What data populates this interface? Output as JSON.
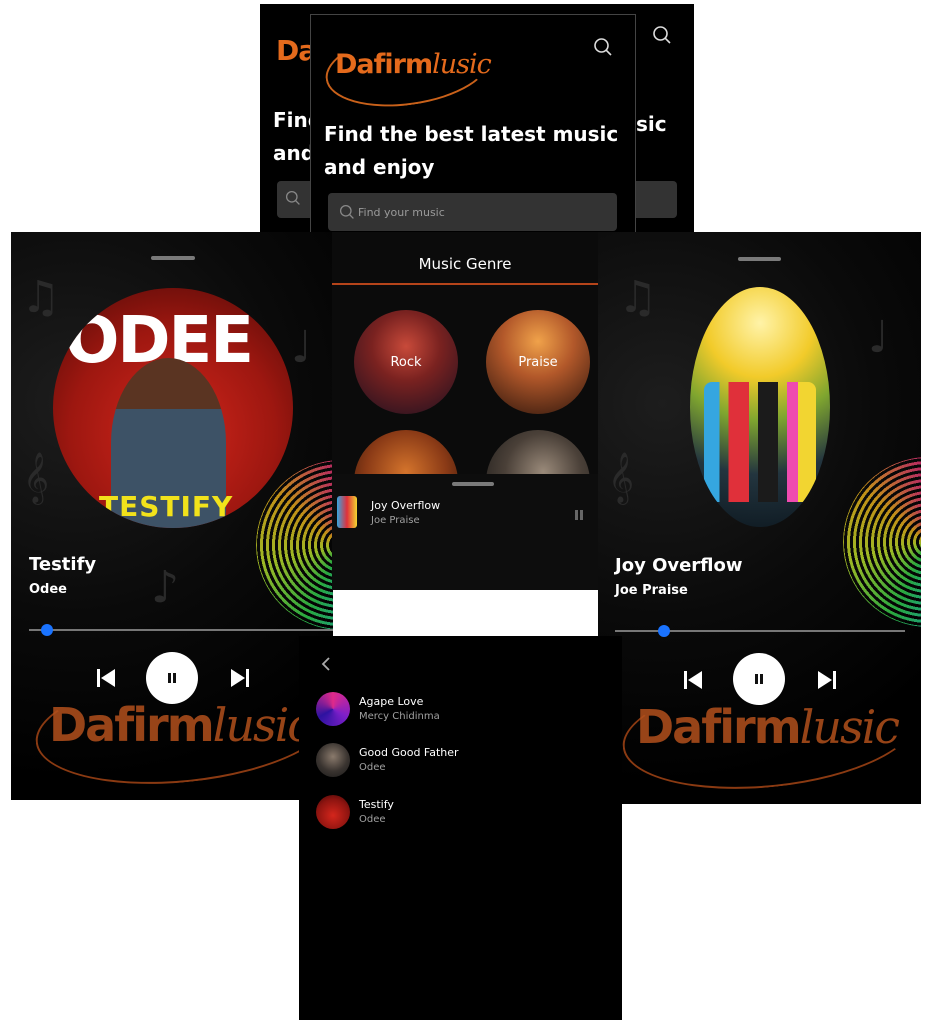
{
  "logo": {
    "part1": "Dafirm",
    "part2": "lusic"
  },
  "home": {
    "headline_line1": "Find the best latest music",
    "headline_line2": "and enjoy",
    "search_placeholder": "Find your music",
    "back_headline_line1": "Find",
    "back_headline_line2": "and",
    "back_headline_tail": "sic"
  },
  "player_left": {
    "title": "Testify",
    "artist": "Odee",
    "progress": 0.06,
    "art_text_top": "ODEE",
    "art_text_bottom": "TESTIFY"
  },
  "player_right": {
    "title": "Joy Overflow",
    "artist": "Joe Praise",
    "progress": 0.17
  },
  "genre_screen": {
    "header": "Music Genre",
    "genres": [
      {
        "label": "Rock"
      },
      {
        "label": "Praise"
      }
    ],
    "mini_player": {
      "title": "Joy Overflow",
      "artist": "Joe Praise"
    }
  },
  "song_list": {
    "items": [
      {
        "title": "Agape Love",
        "artist": "Mercy Chidinma"
      },
      {
        "title": "Good Good Father",
        "artist": "Odee"
      },
      {
        "title": "Testify",
        "artist": "Odee"
      }
    ]
  },
  "colors": {
    "accent": "#e46a1c",
    "progress": "#1a73ff",
    "background": "#000000"
  }
}
